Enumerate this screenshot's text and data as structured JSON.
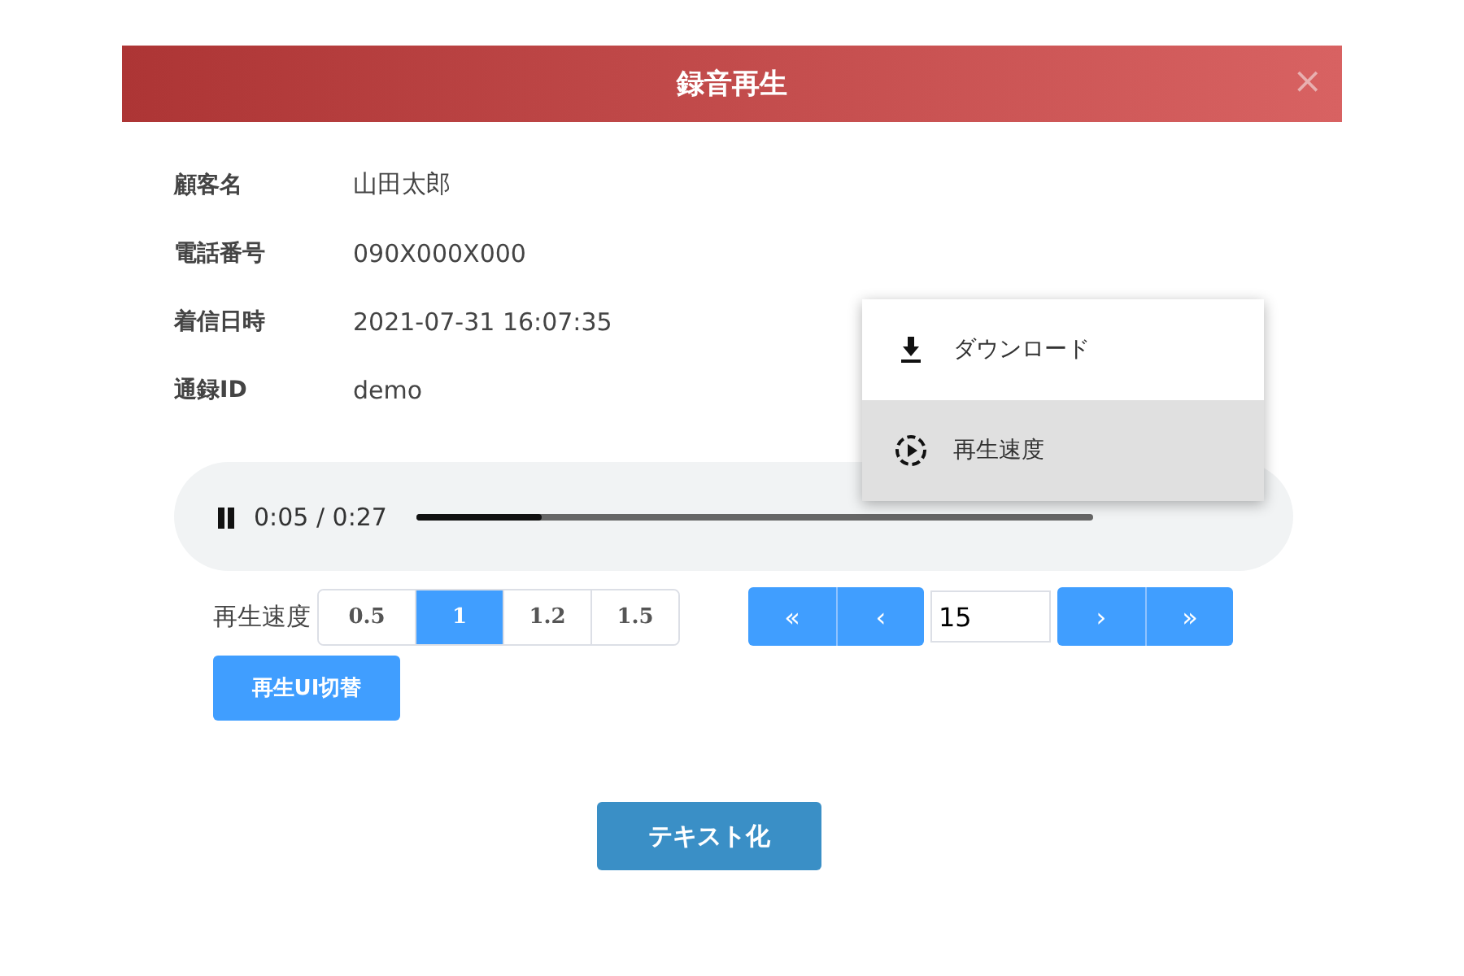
{
  "dialog": {
    "title": "録音再生",
    "close": "×"
  },
  "fields": [
    {
      "label": "顧客名",
      "value": "山田太郎"
    },
    {
      "label": "電話番号",
      "value": "090X000X000"
    },
    {
      "label": "着信日時",
      "value": "2021-07-31 16:07:35"
    },
    {
      "label": "通録ID",
      "value": "demo"
    }
  ],
  "player": {
    "playing": true,
    "time": "0:05 / 0:27",
    "level": 0.185
  },
  "menu": [
    {
      "kind": "download",
      "label": "ダウンロード",
      "selected": false
    },
    {
      "kind": "speed",
      "label": "再生速度",
      "selected": true
    }
  ],
  "speed": {
    "label": "再生速度",
    "options": [
      {
        "label": "0.5",
        "selected": false
      },
      {
        "label": "1",
        "selected": true
      },
      {
        "label": "1.2",
        "selected": false
      },
      {
        "label": "1.5",
        "selected": false
      }
    ]
  },
  "pager": {
    "prev": [
      "«",
      "‹"
    ],
    "value": "15",
    "next": [
      "›",
      "»"
    ]
  },
  "switch_button": "再生UI切替",
  "text_button": "テキスト化"
}
